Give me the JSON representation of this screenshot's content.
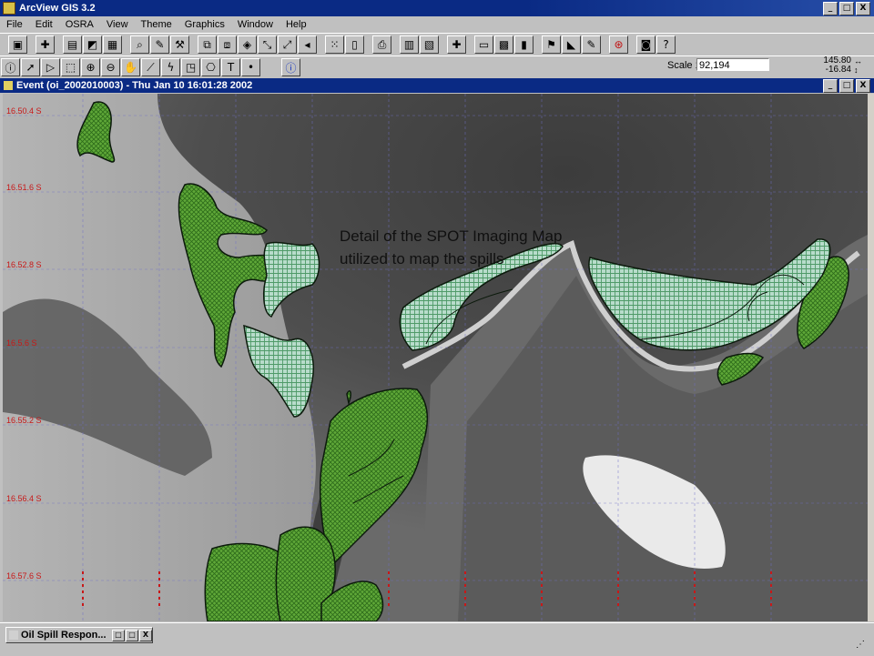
{
  "app": {
    "title": "ArcView GIS 3.2",
    "window_buttons": [
      "_",
      "□",
      "X"
    ]
  },
  "menu": [
    "File",
    "Edit",
    "OSRA",
    "View",
    "Theme",
    "Graphics",
    "Window",
    "Help"
  ],
  "toolbar1": {
    "buttons": [
      "save-icon",
      "add-theme-icon",
      "theme-properties-icon",
      "edit-legend-icon",
      "open-attributes-icon",
      "find-icon",
      "query-builder-icon",
      "locate-address-icon",
      "zoom-full-icon",
      "zoom-active-icon",
      "zoom-selected-icon",
      "zoom-in-fixed-icon",
      "zoom-out-fixed-icon",
      "zoom-previous-icon",
      "select-features-icon",
      "clear-selection-icon",
      "layout-icon",
      "chart-icon",
      "table-icon",
      "help-icon",
      "draw-icon",
      "hotlink-icon",
      "identify-results-icon",
      "print-icon",
      "context-help-icon"
    ]
  },
  "toolbar2": {
    "tools": [
      "identify-tool",
      "pointer-tool",
      "vertex-edit-tool",
      "select-feature-tool",
      "zoom-in-tool",
      "zoom-out-tool",
      "pan-tool",
      "measure-tool",
      "hotlink-tool",
      "area-of-interest-tool",
      "label-tool",
      "text-tool",
      "draw-point-tool",
      "info-tool"
    ],
    "scale_label": "Scale 1:",
    "scale_value": "92,194",
    "coord_x": "145.80",
    "coord_y": "-16.84"
  },
  "view_window": {
    "title": "Event (oi_2002010003) - Thu Jan 10 16:01:28 2002"
  },
  "map": {
    "caption_line1": "Detail of the SPOT Imaging Map",
    "caption_line2": "utilized to map the spills",
    "lat_labels": [
      "16.50.4 S",
      "16.51.6 S",
      "16.52.8 S",
      "16.5.6 S",
      "16.55.2 S",
      "16.56.4 S",
      "16.57.6 S"
    ],
    "colors": {
      "shoreline_fill": "#5fa838",
      "water_spill_fill": "#9fd0b8",
      "outline": "#0c1a0c",
      "grid_label": "#c81818"
    }
  },
  "taskbar": {
    "minimized_window": "Oil Spill Respon..."
  }
}
